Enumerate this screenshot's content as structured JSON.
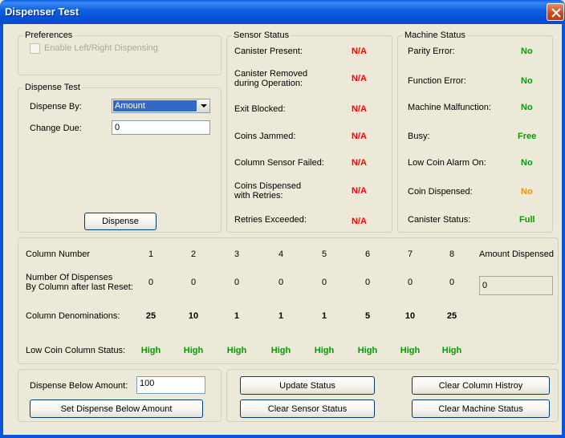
{
  "window": {
    "title": "Dispenser Test"
  },
  "preferences": {
    "legend": "Preferences",
    "checkbox_label": "Enable Left/Right Dispensing",
    "checked": false
  },
  "dispense_test": {
    "legend": "Dispense Test",
    "dispense_by_label": "Dispense By:",
    "dispense_by_value": "Amount",
    "change_due_label": "Change Due:",
    "change_due_value": "0",
    "dispense_button": "Dispense"
  },
  "sensor_status": {
    "legend": "Sensor Status",
    "rows": [
      {
        "label": "Canister Present:",
        "value": "N/A"
      },
      {
        "label": "Canister Removed\nduring Operation:",
        "value": "N/A"
      },
      {
        "label": "Exit Blocked:",
        "value": "N/A"
      },
      {
        "label": "Coins Jammed:",
        "value": "N/A"
      },
      {
        "label": "Column Sensor Failed:",
        "value": "N/A"
      },
      {
        "label": "Coins Dispensed\nwith Retries:",
        "value": "N/A"
      },
      {
        "label": "Retries Exceeded:",
        "value": "N/A"
      }
    ]
  },
  "machine_status": {
    "legend": "Machine Status",
    "rows": [
      {
        "label": "Parity Error:",
        "value": "No"
      },
      {
        "label": "Function Error:",
        "value": "No"
      },
      {
        "label": "Machine Malfunction:",
        "value": "No"
      },
      {
        "label": "Busy:",
        "value": "Free"
      },
      {
        "label": "Low Coin Alarm On:",
        "value": "No"
      },
      {
        "label": "Coin Dispensed:",
        "value": "No"
      },
      {
        "label": "Canister Status:",
        "value": "Full"
      }
    ]
  },
  "columns": {
    "column_number_label": "Column Number",
    "numbers": [
      "1",
      "2",
      "3",
      "4",
      "5",
      "6",
      "7",
      "8"
    ],
    "dispenses_label": "Number Of Dispenses\nBy Column after last Reset:",
    "dispenses": [
      "0",
      "0",
      "0",
      "0",
      "0",
      "0",
      "0",
      "0"
    ],
    "denominations_label": "Column Denominations:",
    "denominations": [
      "25",
      "10",
      "1",
      "1",
      "1",
      "5",
      "10",
      "25"
    ],
    "low_coin_label": "Low Coin Column Status:",
    "low_coin": [
      "High",
      "High",
      "High",
      "High",
      "High",
      "High",
      "High",
      "High"
    ],
    "amount_dispensed_label": "Amount Dispensed",
    "amount_dispensed_value": "0"
  },
  "bottom": {
    "below_amount_label": "Dispense Below Amount:",
    "below_amount_value": "100",
    "set_below_button": "Set Dispense Below Amount",
    "update_status_button": "Update Status",
    "clear_sensor_button": "Clear Sensor Status",
    "clear_column_button": "Clear Column Histroy",
    "clear_machine_button": "Clear Machine Status"
  },
  "colors": {
    "red": "#FF0000",
    "green": "#00A000",
    "orange": "#FF8C00",
    "titlebar": "#0A5FE5"
  },
  "icons": {
    "close": "close-icon",
    "dropdown": "chevron-down-icon",
    "checkbox": "checkbox-icon"
  }
}
